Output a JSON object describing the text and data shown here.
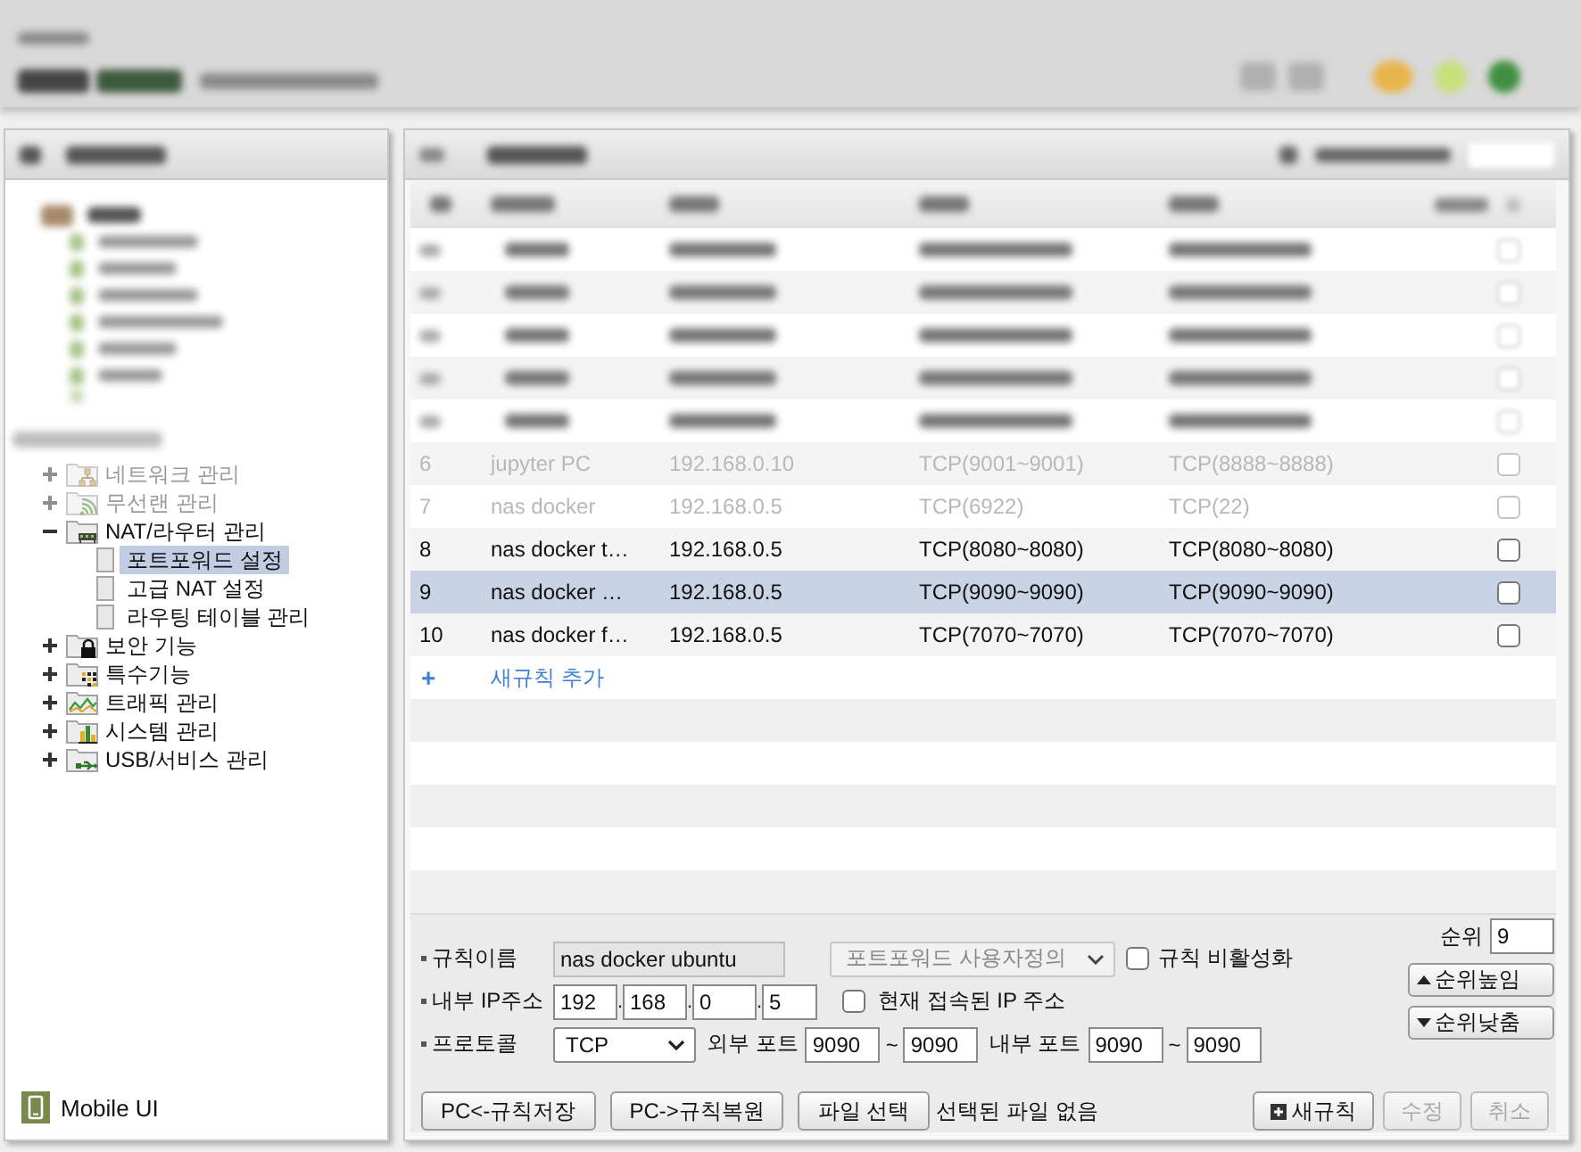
{
  "sidebar": {
    "items": [
      {
        "label": "네트워크 관리",
        "kind": "faded",
        "expanded": false,
        "selected": false
      },
      {
        "label": "무선랜 관리",
        "kind": "faded",
        "expanded": false,
        "selected": false
      },
      {
        "label": "NAT/라우터 관리",
        "kind": "normal",
        "expanded": true,
        "selected": false,
        "children": [
          {
            "label": "포트포워드 설정",
            "selected": true
          },
          {
            "label": "고급 NAT 설정",
            "selected": false
          },
          {
            "label": "라우팅 테이블 관리",
            "selected": false
          }
        ]
      },
      {
        "label": "보안 기능",
        "kind": "normal",
        "expanded": false,
        "selected": false
      },
      {
        "label": "특수기능",
        "kind": "normal",
        "expanded": false,
        "selected": false
      },
      {
        "label": "트래픽 관리",
        "kind": "normal",
        "expanded": false,
        "selected": false
      },
      {
        "label": "시스템 관리",
        "kind": "normal",
        "expanded": false,
        "selected": false
      },
      {
        "label": "USB/서비스 관리",
        "kind": "normal",
        "expanded": false,
        "selected": false
      }
    ],
    "mobile_link": {
      "label": "Mobile UI"
    }
  },
  "table": {
    "rows": [
      {
        "kind": "blurred",
        "selected": false,
        "checked": false
      },
      {
        "kind": "blurred",
        "selected": false,
        "checked": false
      },
      {
        "kind": "blurred",
        "selected": false,
        "checked": false
      },
      {
        "kind": "blurred",
        "selected": false,
        "checked": false
      },
      {
        "kind": "blurred",
        "selected": false,
        "checked": false
      },
      {
        "kind": "faded",
        "number": "6",
        "name": "jupyter PC",
        "internal_ip": "192.168.0.10",
        "external_port": "TCP(9001~9001)",
        "internal_port": "TCP(8888~8888)",
        "selected": false,
        "checked": false
      },
      {
        "kind": "faded",
        "number": "7",
        "name": "nas docker",
        "internal_ip": "192.168.0.5",
        "external_port": "TCP(6922)",
        "internal_port": "TCP(22)",
        "selected": false,
        "checked": false
      },
      {
        "kind": "normal",
        "number": "8",
        "name": "nas docker t…",
        "internal_ip": "192.168.0.5",
        "external_port": "TCP(8080~8080)",
        "internal_port": "TCP(8080~8080)",
        "selected": false,
        "checked": false
      },
      {
        "kind": "normal",
        "number": "9",
        "name": "nas docker …",
        "internal_ip": "192.168.0.5",
        "external_port": "TCP(9090~9090)",
        "internal_port": "TCP(9090~9090)",
        "selected": true,
        "checked": false
      },
      {
        "kind": "normal",
        "number": "10",
        "name": "nas docker f…",
        "internal_ip": "192.168.0.5",
        "external_port": "TCP(7070~7070)",
        "internal_port": "TCP(7070~7070)",
        "selected": false,
        "checked": false
      }
    ],
    "add_row": {
      "plus": "+",
      "label": "새규칙 추가"
    }
  },
  "form": {
    "rule_name": {
      "label": "규칙이름",
      "value": "nas docker ubuntu",
      "readonly": true
    },
    "preset": {
      "value": "포트포워드 사용자정의",
      "disabled": true
    },
    "disable_rule": {
      "label": "규칙 비활성화",
      "checked": false
    },
    "internal_ip": {
      "label": "내부 IP주소",
      "octets": [
        "192",
        "168",
        "0",
        "5"
      ],
      "separators": [
        ".",
        ".",
        "."
      ]
    },
    "current_ip": {
      "label": "현재 접속된 IP 주소",
      "checked": false
    },
    "protocol": {
      "label": "프로토콜",
      "value": "TCP"
    },
    "ports": [
      {
        "label": "외부 포트",
        "from": "9090",
        "separator": "~",
        "to": "9090"
      },
      {
        "label": "내부 포트",
        "from": "9090",
        "separator": "~",
        "to": "9090"
      }
    ],
    "rank": {
      "label": "순위",
      "value": "9"
    },
    "rank_buttons": [
      {
        "kind": "up",
        "label": "순위높임"
      },
      {
        "kind": "down",
        "label": "순위낮춤"
      }
    ]
  },
  "bottom_bar": {
    "left_buttons": [
      {
        "label": "PC<-규칙저장"
      },
      {
        "label": "PC->규칙복원"
      },
      {
        "label": "파일 선택"
      }
    ],
    "file_status": "선택된 파일 없음",
    "right_buttons": [
      {
        "kind": "new",
        "label": "새규칙",
        "disabled": false
      },
      {
        "kind": "plain",
        "label": "수정",
        "disabled": true
      },
      {
        "kind": "plain",
        "label": "취소",
        "disabled": true
      }
    ]
  }
}
